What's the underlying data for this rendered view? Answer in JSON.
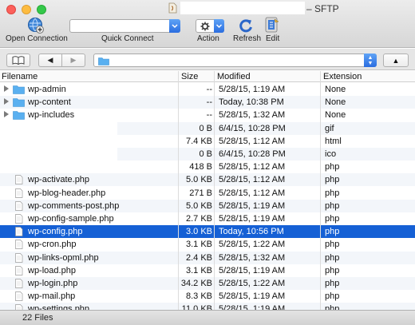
{
  "window": {
    "title_suffix": "– SFTP",
    "colors": {
      "selection": "#1560d5",
      "folder": "#5ab0f0",
      "dropdown_accent": "#2a6de0"
    }
  },
  "toolbar": {
    "open_connection_label": "Open Connection",
    "quick_connect_label": "Quick Connect",
    "quick_connect_value": "",
    "action_label": "Action",
    "refresh_label": "Refresh",
    "edit_label": "Edit"
  },
  "pathbar": {
    "bookmarks_icon": "book-icon",
    "back_glyph": "◀",
    "forward_glyph": "▶",
    "up_glyph": "▲",
    "path_value": ""
  },
  "table": {
    "columns": {
      "filename": "Filename",
      "size": "Size",
      "modified": "Modified",
      "extension": "Extension"
    },
    "rows": [
      {
        "name": "wp-admin",
        "size": "--",
        "modified": "5/28/15, 1:19 AM",
        "ext": "None",
        "type": "folder"
      },
      {
        "name": "wp-content",
        "size": "--",
        "modified": "Today, 10:38 PM",
        "ext": "None",
        "type": "folder"
      },
      {
        "name": "wp-includes",
        "size": "--",
        "modified": "5/28/15, 1:32 AM",
        "ext": "None",
        "type": "folder"
      },
      {
        "name": "",
        "size": "0 B",
        "modified": "6/4/15, 10:28 PM",
        "ext": "gif",
        "type": "hidden"
      },
      {
        "name": "",
        "size": "7.4 KB",
        "modified": "5/28/15, 1:12 AM",
        "ext": "html",
        "type": "hidden"
      },
      {
        "name": "",
        "size": "0 B",
        "modified": "6/4/15, 10:28 PM",
        "ext": "ico",
        "type": "hidden"
      },
      {
        "name": "",
        "size": "418 B",
        "modified": "5/28/15, 1:12 AM",
        "ext": "php",
        "type": "hidden"
      },
      {
        "name": "wp-activate.php",
        "size": "5.0 KB",
        "modified": "5/28/15, 1:12 AM",
        "ext": "php",
        "type": "file"
      },
      {
        "name": "wp-blog-header.php",
        "size": "271 B",
        "modified": "5/28/15, 1:12 AM",
        "ext": "php",
        "type": "file"
      },
      {
        "name": "wp-comments-post.php",
        "size": "5.0 KB",
        "modified": "5/28/15, 1:19 AM",
        "ext": "php",
        "type": "file"
      },
      {
        "name": "wp-config-sample.php",
        "size": "2.7 KB",
        "modified": "5/28/15, 1:19 AM",
        "ext": "php",
        "type": "file"
      },
      {
        "name": "wp-config.php",
        "size": "3.0 KB",
        "modified": "Today, 10:56 PM",
        "ext": "php",
        "type": "file",
        "selected": true
      },
      {
        "name": "wp-cron.php",
        "size": "3.1 KB",
        "modified": "5/28/15, 1:22 AM",
        "ext": "php",
        "type": "file"
      },
      {
        "name": "wp-links-opml.php",
        "size": "2.4 KB",
        "modified": "5/28/15, 1:32 AM",
        "ext": "php",
        "type": "file"
      },
      {
        "name": "wp-load.php",
        "size": "3.1 KB",
        "modified": "5/28/15, 1:19 AM",
        "ext": "php",
        "type": "file"
      },
      {
        "name": "wp-login.php",
        "size": "34.2 KB",
        "modified": "5/28/15, 1:22 AM",
        "ext": "php",
        "type": "file"
      },
      {
        "name": "wp-mail.php",
        "size": "8.3 KB",
        "modified": "5/28/15, 1:19 AM",
        "ext": "php",
        "type": "file"
      },
      {
        "name": "wp-settings.php",
        "size": "11.0 KB",
        "modified": "5/28/15, 1:19 AM",
        "ext": "php",
        "type": "file"
      }
    ]
  },
  "status": {
    "text": "22 Files"
  }
}
